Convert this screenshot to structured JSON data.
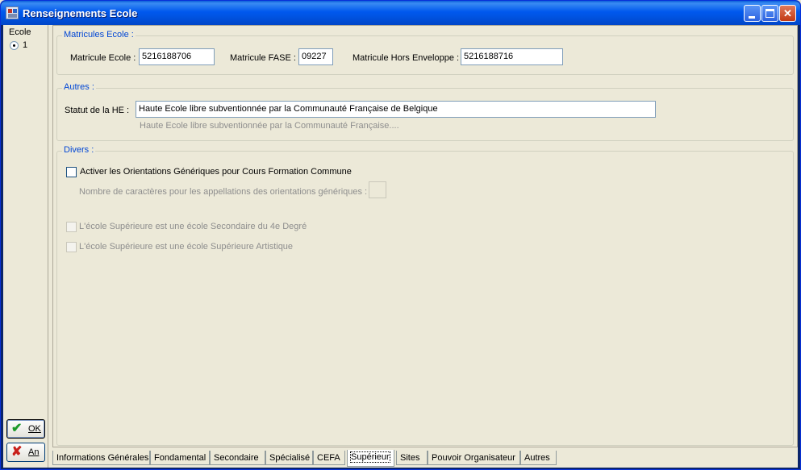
{
  "window": {
    "title": "Renseignements Ecole",
    "buttons": [
      "minimize",
      "maximize",
      "close"
    ]
  },
  "sidebar": {
    "label": "Ecole",
    "radio_value": "1",
    "ok_label": "OK",
    "an_label": "An"
  },
  "matricules": {
    "title": "Matricules Ecole :",
    "ecole_label": "Matricule Ecole :",
    "ecole_value": "5216188706",
    "fase_label": "Matricule FASE :",
    "fase_value": "09227",
    "hors_label": "Matricule Hors Enveloppe :",
    "hors_value": "5216188716"
  },
  "autres": {
    "title": "Autres :",
    "statut_label": "Statut de la HE :",
    "statut_value": "Haute Ecole libre subventionnée par la Communauté Française de Belgique",
    "statut_hint": "Haute Ecole libre subventionnée par la Communauté Française...."
  },
  "divers": {
    "title": "Divers :",
    "activer_label": "Activer les Orientations Génériques pour Cours Formation Commune",
    "nombre_label": "Nombre de caractères pour les appellations des orientations génériques :",
    "nombre_value": "",
    "secondaire_label": "L'école Supérieure est une école Secondaire du 4e Degré",
    "artistique_label": "L'école Supérieure est une école Supérieure Artistique"
  },
  "tabs": [
    "Informations Générales",
    "Fondamental",
    "Secondaire",
    "Spécialisé",
    "CEFA",
    "Supérieur",
    "Sites",
    "Pouvoir Organisateur",
    "Autres"
  ],
  "active_tab": "Supérieur",
  "colors": {
    "titlebar": "#0058ee",
    "group_title": "#0046d5",
    "background": "#ece9d8"
  }
}
